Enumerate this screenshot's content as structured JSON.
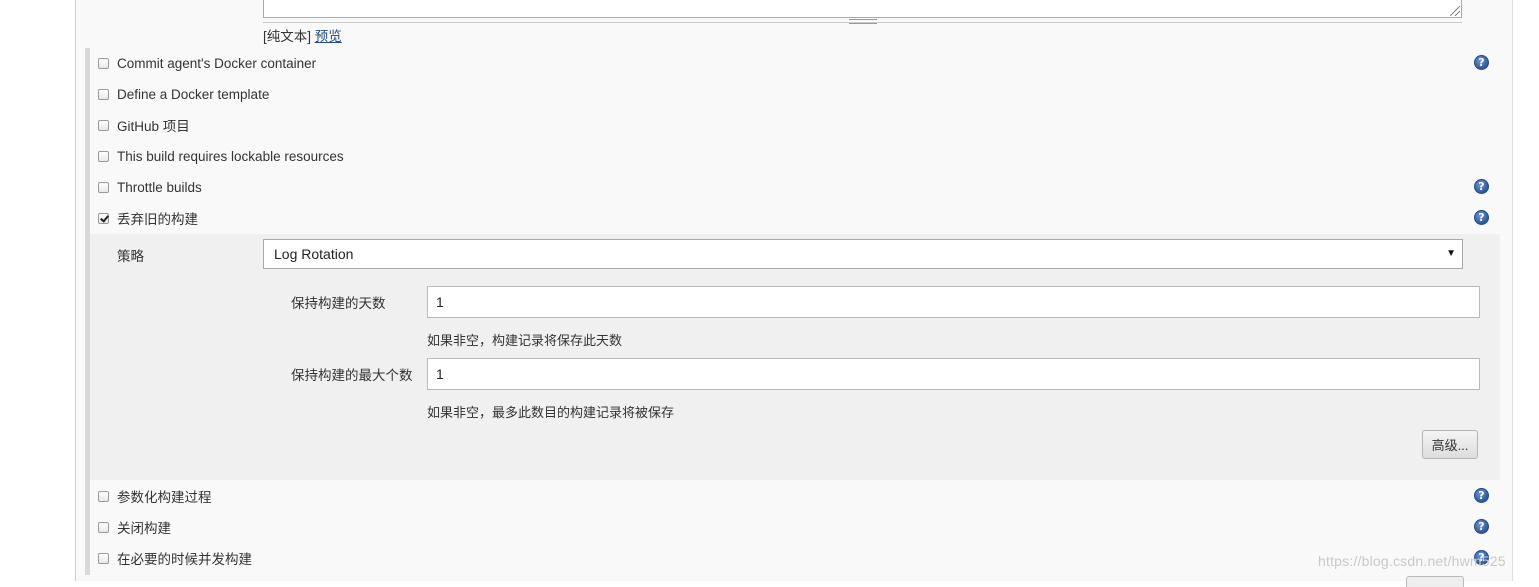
{
  "description_area": {
    "plain_text_label": "[纯文本]",
    "preview_link": "预览"
  },
  "options": [
    {
      "label": "Commit agent's Docker container",
      "checked": false,
      "help": true
    },
    {
      "label": "Define a Docker template",
      "checked": false,
      "help": false
    },
    {
      "label": "GitHub 项目",
      "checked": false,
      "help": false
    },
    {
      "label": "This build requires lockable resources",
      "checked": false,
      "help": false
    },
    {
      "label": "Throttle builds",
      "checked": false,
      "help": true
    },
    {
      "label": "丢弃旧的构建",
      "checked": true,
      "help": true
    }
  ],
  "discard_old_builds": {
    "strategy_label": "策略",
    "strategy_value": "Log Rotation",
    "days_label": "保持构建的天数",
    "days_value": "1",
    "days_hint": "如果非空，构建记录将保存此天数",
    "max_label": "保持构建的最大个数",
    "max_value": "1",
    "max_hint": "如果非空，最多此数目的构建记录将被保存",
    "advanced_button": "高级..."
  },
  "options_after": [
    {
      "label": "参数化构建过程",
      "checked": false,
      "help": true
    },
    {
      "label": "关闭构建",
      "checked": false,
      "help": true
    },
    {
      "label": "在必要的时候并发构建",
      "checked": false,
      "help": true
    }
  ],
  "help_glyph": "?",
  "select_arrow": "▼",
  "watermark": "https://blog.csdn.net/hwm525"
}
